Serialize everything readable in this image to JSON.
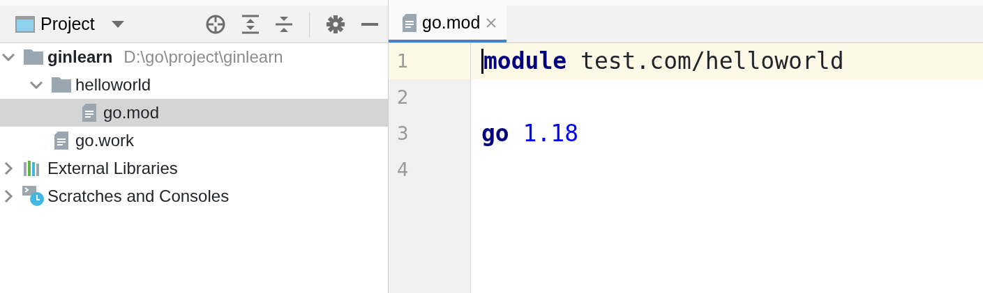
{
  "project_view": {
    "title": "Project",
    "tree": [
      {
        "label": "ginlearn",
        "path": "D:\\go\\project\\ginlearn",
        "kind": "folder",
        "expanded": true,
        "selected": false,
        "children": [
          {
            "label": "helloworld",
            "kind": "folder",
            "expanded": true,
            "selected": false,
            "children": [
              {
                "label": "go.mod",
                "kind": "file",
                "selected": true
              }
            ]
          },
          {
            "label": "go.work",
            "kind": "file",
            "selected": false
          }
        ]
      },
      {
        "label": "External Libraries",
        "kind": "library",
        "expanded": false,
        "selected": false
      },
      {
        "label": "Scratches and Consoles",
        "kind": "scratches",
        "expanded": false,
        "selected": false
      }
    ]
  },
  "editor": {
    "tabs": [
      {
        "label": "go.mod",
        "selected": true
      }
    ],
    "lines": [
      {
        "number": "1",
        "current": true,
        "tokens": [
          {
            "text": "module",
            "kind": "keyword"
          },
          {
            "text": "test.com/helloworld",
            "kind": "plain"
          }
        ]
      },
      {
        "number": "2",
        "current": false
      },
      {
        "number": "3",
        "current": false,
        "tokens": [
          {
            "text": "go",
            "kind": "keyword"
          },
          {
            "text": "1.18",
            "kind": "number"
          }
        ]
      },
      {
        "number": "4",
        "current": false
      }
    ]
  }
}
